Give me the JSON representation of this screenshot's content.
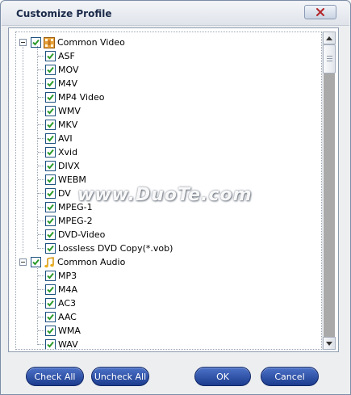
{
  "window": {
    "title": "Customize Profile"
  },
  "tree": {
    "categories": [
      {
        "label": "Common Video",
        "icon": "film-icon",
        "checked": true,
        "items": [
          "ASF",
          "MOV",
          "M4V",
          "MP4 Video",
          "WMV",
          "MKV",
          "AVI",
          "Xvid",
          "DIVX",
          "WEBM",
          "DV",
          "MPEG-1",
          "MPEG-2",
          "DVD-Video",
          "Lossless DVD Copy(*.vob)"
        ]
      },
      {
        "label": "Common Audio",
        "icon": "music-note-icon",
        "checked": true,
        "items": [
          "MP3",
          "M4A",
          "AC3",
          "AAC",
          "WMA",
          "WAV"
        ]
      }
    ]
  },
  "buttons": {
    "check_all": "Check All",
    "uncheck_all": "Uncheck All",
    "ok": "OK",
    "cancel": "Cancel"
  },
  "watermark": "www.DuoTe.com",
  "colors": {
    "button_top": "#4c72c8",
    "button_bottom": "#1c3c8e",
    "check_mark": "#2a9b2a",
    "scroll_track": "#a9a9a9"
  }
}
